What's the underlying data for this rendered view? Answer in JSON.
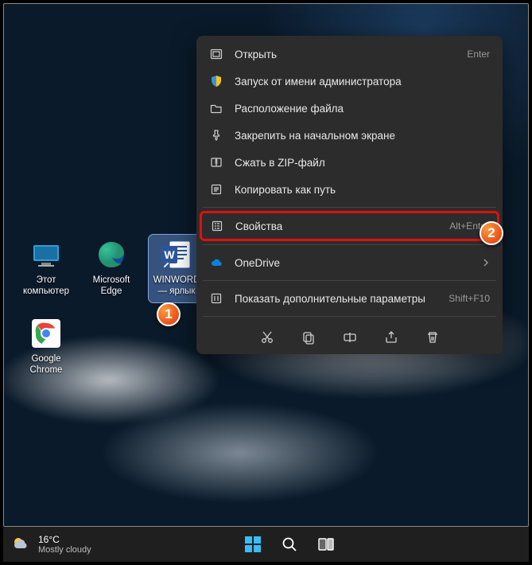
{
  "desktop": {
    "icons": [
      {
        "label": "Этот\nкомпьютер"
      },
      {
        "label": "Google\nChrome"
      },
      {
        "label": "Microsoft\nEdge"
      },
      {
        "label": "WINWORD\n— ярлык"
      }
    ]
  },
  "context_menu": {
    "items": [
      {
        "label": "Открыть",
        "shortcut": "Enter",
        "icon": "open-icon"
      },
      {
        "label": "Запуск от имени администратора",
        "shortcut": "",
        "icon": "shield-icon"
      },
      {
        "label": "Расположение файла",
        "shortcut": "",
        "icon": "folder-icon"
      },
      {
        "label": "Закрепить на начальном экране",
        "shortcut": "",
        "icon": "pin-icon"
      },
      {
        "label": "Сжать в ZIP-файл",
        "shortcut": "",
        "icon": "zip-icon"
      },
      {
        "label": "Копировать как путь",
        "shortcut": "",
        "icon": "copy-path-icon"
      }
    ],
    "properties": {
      "label": "Свойства",
      "shortcut": "Alt+Enter",
      "icon": "properties-icon"
    },
    "onedrive": {
      "label": "OneDrive",
      "icon": "cloud-icon"
    },
    "more": {
      "label": "Показать дополнительные параметры",
      "shortcut": "Shift+F10",
      "icon": "more-icon"
    },
    "bottom_actions": [
      "cut",
      "copy",
      "rename",
      "share",
      "delete"
    ]
  },
  "callouts": {
    "one": "1",
    "two": "2"
  },
  "taskbar": {
    "weather_temp": "16°C",
    "weather_desc": "Mostly cloudy"
  }
}
